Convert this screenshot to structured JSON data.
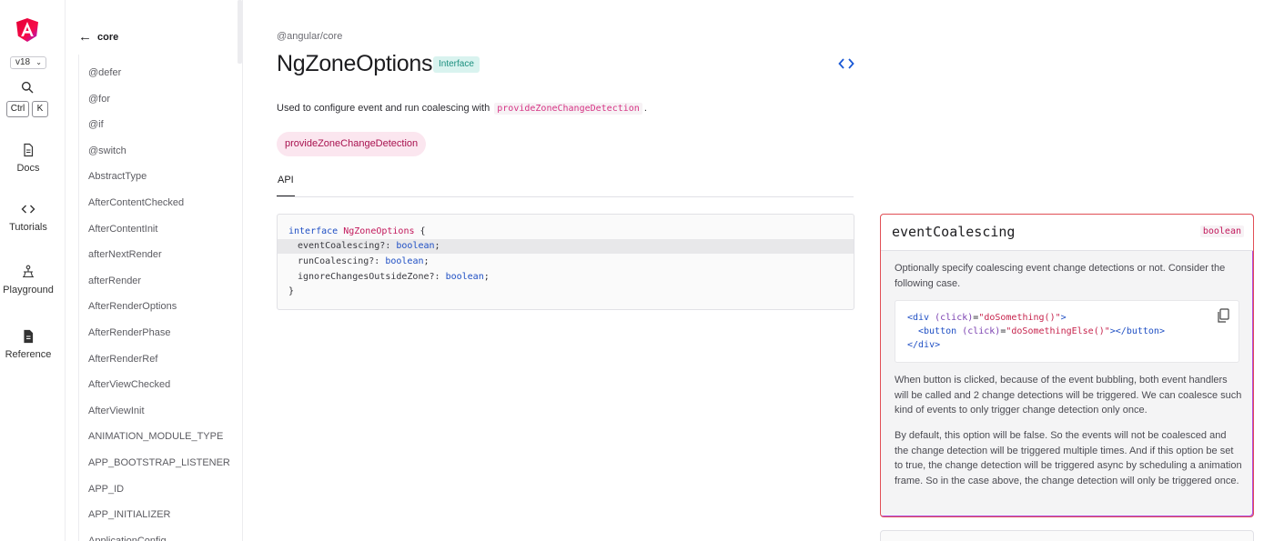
{
  "rail": {
    "version": "v18",
    "kbd_ctrl": "Ctrl",
    "kbd_k": "K",
    "items": [
      {
        "label": "Docs",
        "icon": "document-icon"
      },
      {
        "label": "Tutorials",
        "icon": "code-icon"
      },
      {
        "label": "Playground",
        "icon": "playground-icon"
      },
      {
        "label": "Reference",
        "icon": "reference-icon"
      }
    ]
  },
  "sidebar": {
    "back_label": "core",
    "items": [
      "@defer",
      "@for",
      "@if",
      "@switch",
      "AbstractType",
      "AfterContentChecked",
      "AfterContentInit",
      "afterNextRender",
      "afterRender",
      "AfterRenderOptions",
      "AfterRenderPhase",
      "AfterRenderRef",
      "AfterViewChecked",
      "AfterViewInit",
      "ANIMATION_MODULE_TYPE",
      "APP_BOOTSTRAP_LISTENER",
      "APP_ID",
      "APP_INITIALIZER",
      "ApplicationConfig"
    ]
  },
  "main": {
    "breadcrumb": "@angular/core",
    "title": "NgZoneOptions",
    "badge": "Interface",
    "desc_before": "Used to configure event and run coalescing with",
    "desc_code": "provideZoneChangeDetection",
    "desc_after": ".",
    "related_pill": "provideZoneChangeDetection",
    "tab": "API",
    "code": {
      "l1_kw": "interface",
      "l1_name": "NgZoneOptions",
      "l1_brace": " {",
      "members": [
        {
          "name": "eventCoalescing?:",
          "type": "boolean"
        },
        {
          "name": "runCoalescing?:",
          "type": "boolean"
        },
        {
          "name": "ignoreChangesOutsideZone?:",
          "type": "boolean"
        }
      ],
      "close": "}"
    }
  },
  "detail": {
    "name": "eventCoalescing",
    "type": "boolean",
    "p1": "Optionally specify coalescing event change detections or not. Consider the following case.",
    "snippet": {
      "l1_open": "<div",
      "l1_attr": "(click)",
      "l1_eq": "=",
      "l1_val": "\"doSomething()\"",
      "l1_close": ">",
      "l2_open": "<button",
      "l2_attr": "(click)",
      "l2_eq": "=",
      "l2_val": "\"doSomethingElse()\"",
      "l2_close": "></button>",
      "l3": "</div>"
    },
    "p2": "When button is clicked, because of the event bubbling, both event handlers will be called and 2 change detections will be triggered. We can coalesce such kind of events to only trigger change detection only once.",
    "p3": "By default, this option will be false. So the events will not be coalesced and the change detection will be triggered multiple times. And if this option be set to true, the change detection will be triggered async by scheduling a animation frame. So in the case above, the change detection will only be triggered once."
  }
}
